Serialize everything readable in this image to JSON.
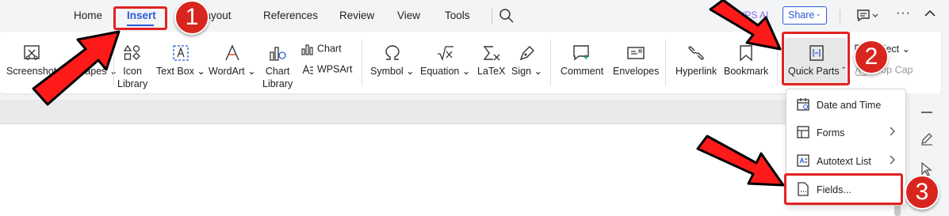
{
  "tabs": {
    "home": "Home",
    "insert": "Insert",
    "layout": "Layout",
    "references": "References",
    "review": "Review",
    "view": "View",
    "tools": "Tools"
  },
  "topbar": {
    "wps_ai": "WPS AI",
    "share": "Share"
  },
  "ribbon": {
    "screenshot": "Screenshot",
    "shapes": "Shapes",
    "icon_library_1": "Icon",
    "icon_library_2": "Library",
    "text_box": "Text Box",
    "wordart": "WordArt",
    "chart_library_1": "Chart",
    "chart_library_2": "Library",
    "chart": "Chart",
    "wpsart": "WPSArt",
    "symbol": "Symbol",
    "equation": "Equation",
    "latex": "LaTeX",
    "sign": "Sign",
    "comment": "Comment",
    "envelopes": "Envelopes",
    "hyperlink": "Hyperlink",
    "bookmark": "Bookmark",
    "quick_parts": "Quick Parts",
    "object": "Object",
    "drop_cap": "Drop Cap"
  },
  "quick_parts_menu": {
    "date_time": "Date and Time",
    "forms": "Forms",
    "autotext_list": "Autotext List",
    "fields": "Fields..."
  },
  "annotations": {
    "step1": "1",
    "step2": "2",
    "step3": "3"
  },
  "colors": {
    "accent": "#2a5bd7",
    "annotation_red": "#e22323",
    "badge_red": "#d8261f"
  }
}
